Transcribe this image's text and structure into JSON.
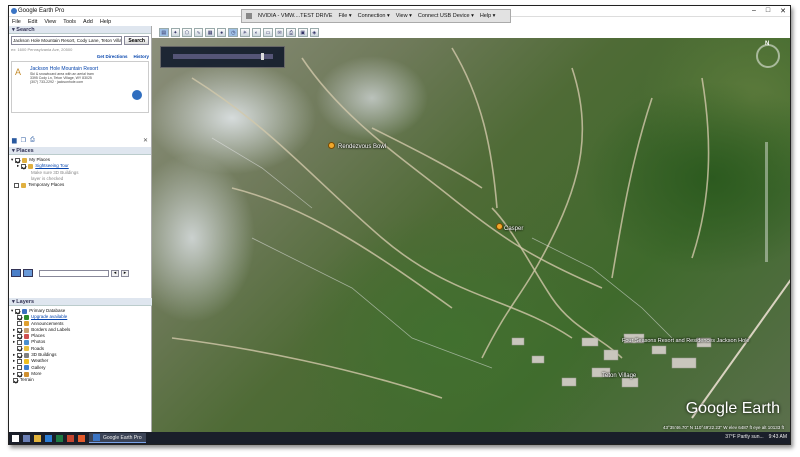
{
  "window": {
    "title": "Google Earth Pro",
    "controls": [
      "–",
      "□",
      "✕"
    ]
  },
  "menu": [
    "File",
    "Edit",
    "View",
    "Tools",
    "Add",
    "Help"
  ],
  "remote_bar": {
    "title": "NVIDIA - VMW....TEST DRIVE",
    "items": [
      "File ▾",
      "Connection ▾",
      "View ▾",
      "Connect USB Device ▾",
      "Help ▾"
    ]
  },
  "search": {
    "header": "Search",
    "query": "Jackson Hole Mountain Resort, Cody Lane, Teton Village, WY",
    "button": "Search",
    "hint": "ex: 1600 Pennsylvania Ave, 20500",
    "get_directions": "Get Directions",
    "history": "History",
    "result": {
      "title": "Jackson Hole Mountain Resort",
      "desc_lines": [
        "Ski & snowboard area with an aerial tram",
        "3395 Cody Ln, Teton Village, WY 83025",
        "(307) 733-2292 · jacksonhole.com"
      ]
    }
  },
  "places": {
    "header": "Places",
    "items": [
      {
        "label": "My Places",
        "checked": true,
        "level": 0
      },
      {
        "label": "Sightseeing Tour",
        "checked": true,
        "level": 1,
        "link": true
      },
      {
        "label": "Make sure 3D Buildings",
        "level": 2,
        "note": true
      },
      {
        "label": "layer is checked",
        "level": 2,
        "note": true
      },
      {
        "label": "Temporary Places",
        "checked": false,
        "level": 0
      }
    ]
  },
  "layers": {
    "header": "Layers",
    "items": [
      {
        "label": "Primary Database",
        "checked": true,
        "color": "#3a6fc0"
      },
      {
        "label": "Upgrade available",
        "checked": true,
        "color": "#2b8b2b",
        "link": true
      },
      {
        "label": "Announcements",
        "checked": false,
        "color": "#e0a030"
      },
      {
        "label": "Borders and Labels",
        "checked": true,
        "color": "#c8a070"
      },
      {
        "label": "Places",
        "checked": true,
        "color": "#d05050"
      },
      {
        "label": "Photos",
        "checked": false,
        "color": "#4a90d0"
      },
      {
        "label": "Roads",
        "checked": true,
        "color": "#e8c040"
      },
      {
        "label": "3D Buildings",
        "checked": true,
        "color": "#808080"
      },
      {
        "label": "Weather",
        "checked": false,
        "color": "#f0c020"
      },
      {
        "label": "Gallery",
        "checked": false,
        "color": "#4080d0"
      },
      {
        "label": "More",
        "checked": true,
        "color": "#d09030"
      },
      {
        "label": "Terrain",
        "checked": true,
        "color": "#7a9a5a"
      }
    ]
  },
  "map": {
    "labels": [
      {
        "text": "Rendezvous Bowl",
        "name": "label-rendezvous"
      },
      {
        "text": "Casper",
        "name": "label-casper"
      },
      {
        "text": "Four Seasons Resort and Residences Jackson Hole",
        "name": "label-four-seasons"
      },
      {
        "text": "Teton Village",
        "name": "label-teton-village"
      }
    ],
    "brand": "Google Earth",
    "status": "43°35'46.70\" N 110°49'22.23\" W elev 6487 ft eye alt 10133 ft"
  },
  "taskbar": {
    "app": "Google Earth Pro",
    "weather": "37°F Partly sun...",
    "time": "9:43 AM"
  }
}
